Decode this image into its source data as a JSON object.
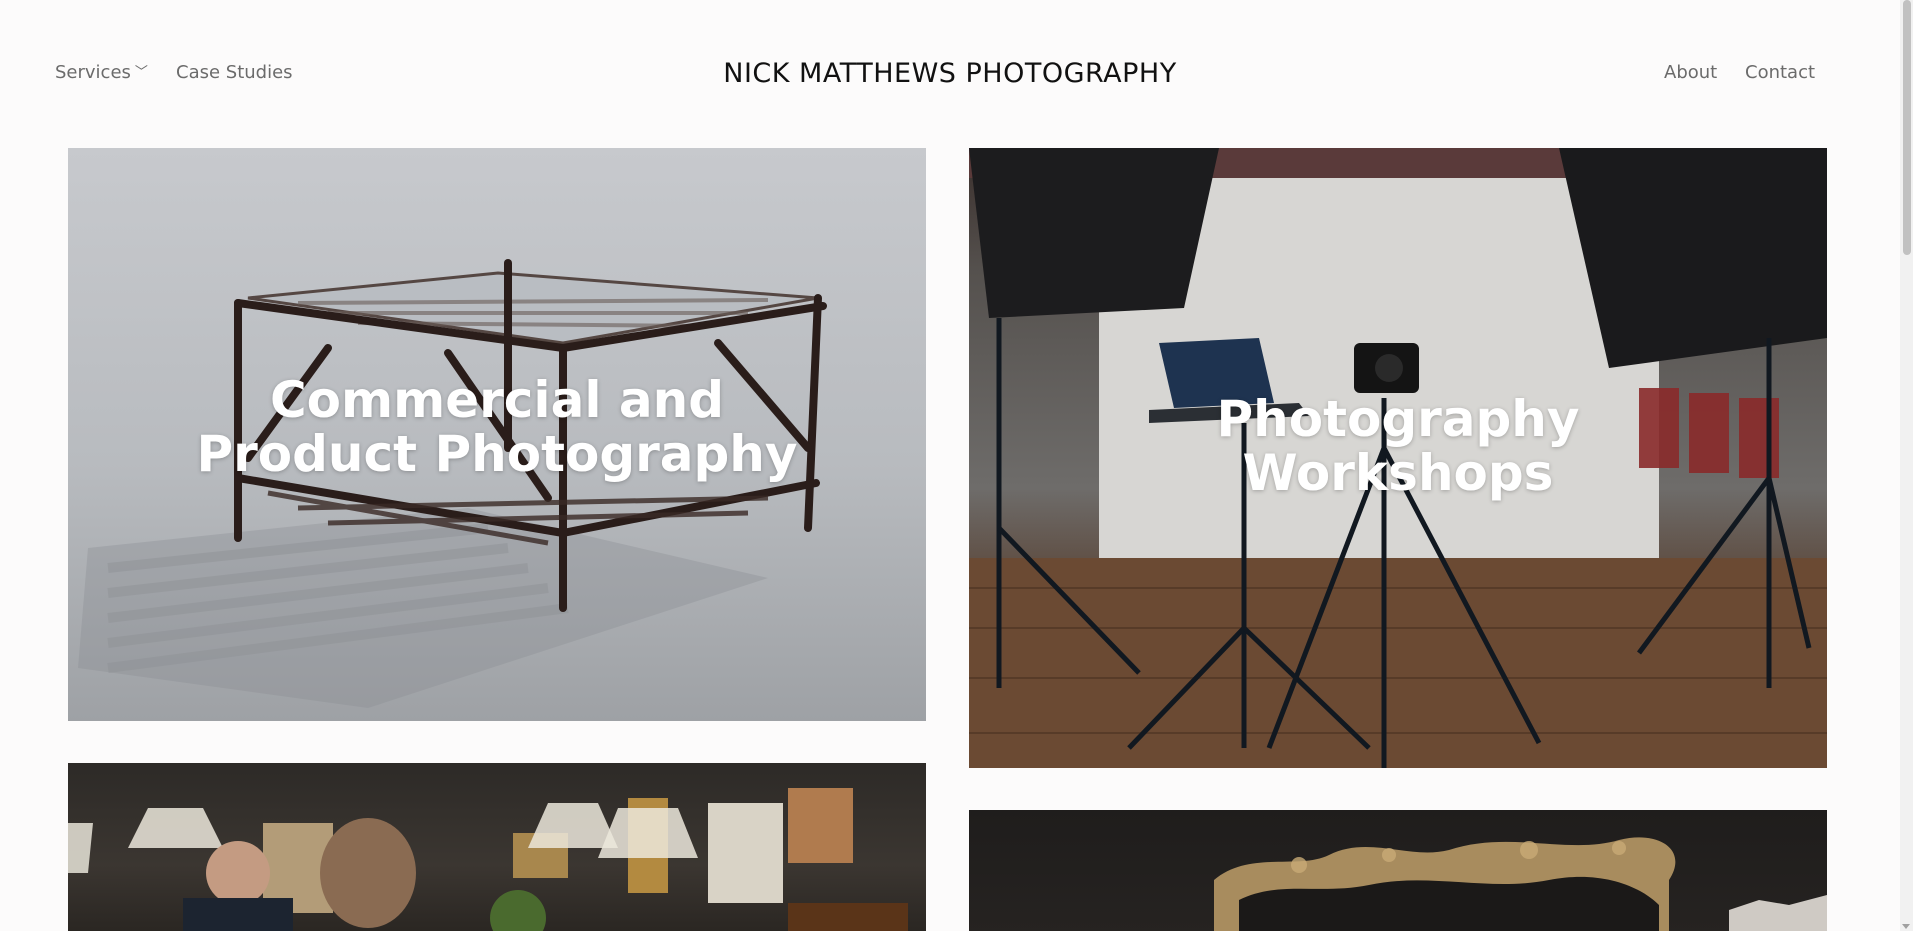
{
  "header": {
    "site_title": "NICK MATTHEWS PHOTOGRAPHY",
    "nav_left": [
      {
        "label": "Services",
        "has_dropdown": true
      },
      {
        "label": "Case Studies"
      }
    ],
    "nav_right": [
      {
        "label": "About"
      },
      {
        "label": "Contact"
      }
    ],
    "dropdown_icon": "chevron-down-icon"
  },
  "tiles": {
    "commercial": {
      "caption": "Commercial and Product Photography"
    },
    "workshops": {
      "caption": "Photography Workshops"
    }
  },
  "colors": {
    "background": "#fcfbfb",
    "nav_text": "#6b6b6b",
    "title_text": "#111111",
    "caption_text": "#ffffff"
  }
}
